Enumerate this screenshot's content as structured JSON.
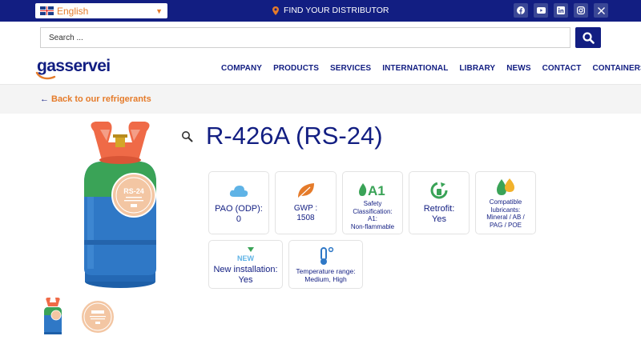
{
  "topbar": {
    "language": "English",
    "distributor": "FIND YOUR DISTRIBUTOR",
    "social": [
      "facebook-icon",
      "youtube-icon",
      "linkedin-icon",
      "instagram-icon",
      "x-icon"
    ]
  },
  "search": {
    "placeholder": "Search ..."
  },
  "brand": {
    "name": "gasservei",
    "primary_color": "#121e82",
    "accent_color": "#e57b2a"
  },
  "nav": {
    "items": [
      "COMPANY",
      "PRODUCTS",
      "SERVICES",
      "INTERNATIONAL",
      "LIBRARY",
      "NEWS",
      "CONTACT",
      "CONTAINERS"
    ]
  },
  "back_link": "Back to our refrigerants",
  "product": {
    "title": "R-426A (RS-24)",
    "cylinder_label": "RS-24",
    "properties": [
      {
        "icon": "cloud-icon",
        "label": "PAO (ODP):\n0"
      },
      {
        "icon": "leaf-icon",
        "label": "GWP :\n1508"
      },
      {
        "icon": "a1-flame-icon",
        "label": "Safety\nClassification:\nA1:\nNon-flammable"
      },
      {
        "icon": "recycle-icon",
        "label": "Retrofit:\nYes"
      },
      {
        "icon": "oil-drops-icon",
        "label": "Compatible\nlubricants:\nMineral / AB /\nPAG / POE"
      },
      {
        "icon": "new-icon",
        "label": "New installation:\nYes"
      },
      {
        "icon": "thermometer-icon",
        "label": "Temperature range:\nMedium, High"
      }
    ]
  }
}
